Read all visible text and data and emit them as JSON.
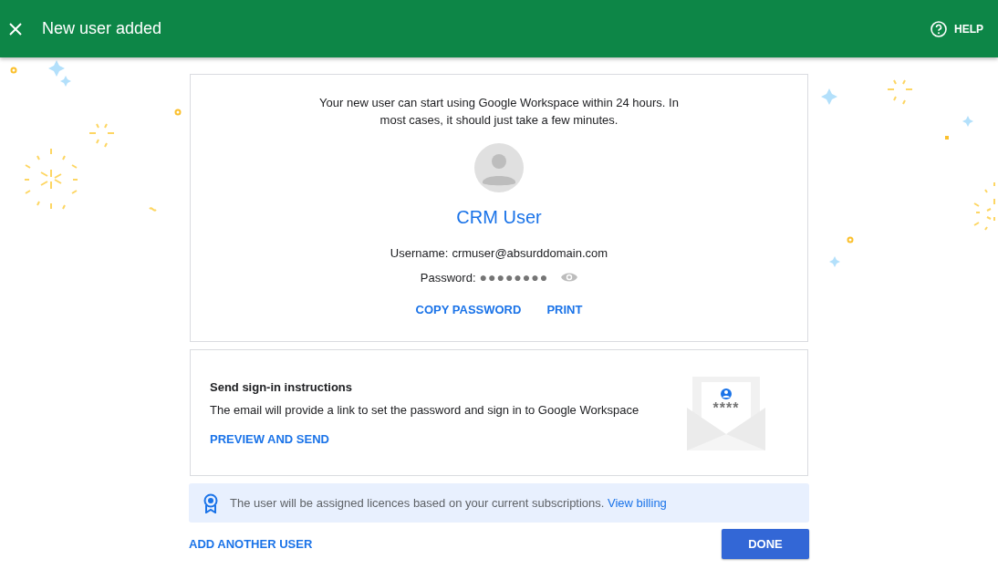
{
  "header": {
    "title": "New user added",
    "help": "HELP"
  },
  "user_card": {
    "message": "Your new user can start using Google Workspace within 24 hours. In most cases, it should just take a few minutes.",
    "name": "CRM User",
    "username_label": "Username:",
    "username": "crmuser@absurddomain.com",
    "password_label": "Password:",
    "password": "●●●●●●●●",
    "actions": [
      "COPY PASSWORD",
      "PRINT"
    ]
  },
  "signin_card": {
    "title": "Send sign-in instructions",
    "description": "The email will provide a link to set the password and sign in to Google Workspace",
    "action": "PREVIEW AND SEND",
    "envelope_mask": "****"
  },
  "info_bar": {
    "message": "The user will be assigned licences based on your current subscriptions.",
    "link": "View billing"
  },
  "footer": {
    "secondary": "ADD ANOTHER USER",
    "primary": "DONE"
  }
}
